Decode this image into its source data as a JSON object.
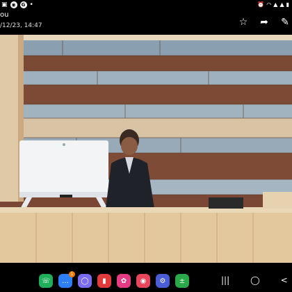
{
  "status": {
    "badge_g": "G",
    "icons_right": [
      "alarm-icon",
      "wifi-icon",
      "signal-icon",
      "signal-icon",
      "battery-icon"
    ]
  },
  "header": {
    "title": "ou",
    "subtitle": "/12/23, 14:47",
    "actions": [
      "star-icon",
      "share-icon",
      "edit-icon"
    ]
  },
  "dock": {
    "apps": [
      {
        "name": "phone",
        "color": "#1fae5a",
        "glyph": "☏",
        "badge": ""
      },
      {
        "name": "messages",
        "color": "#2d7ff9",
        "glyph": "…",
        "badge": "1"
      },
      {
        "name": "chat",
        "color": "#7a6cf0",
        "glyph": "◯",
        "badge": ""
      },
      {
        "name": "flip-cards",
        "color": "#e23b3b",
        "glyph": "▮",
        "badge": ""
      },
      {
        "name": "bixby",
        "color": "#e43c83",
        "glyph": "✿",
        "badge": ""
      },
      {
        "name": "camera",
        "color": "#e8465a",
        "glyph": "◉",
        "badge": ""
      },
      {
        "name": "settings",
        "color": "#4a5dd6",
        "glyph": "⚙",
        "badge": ""
      },
      {
        "name": "calculator",
        "color": "#2aa84a",
        "glyph": "±",
        "badge": ""
      }
    ]
  },
  "nav": {
    "recents": "|||",
    "home": "◯",
    "back": "<"
  }
}
